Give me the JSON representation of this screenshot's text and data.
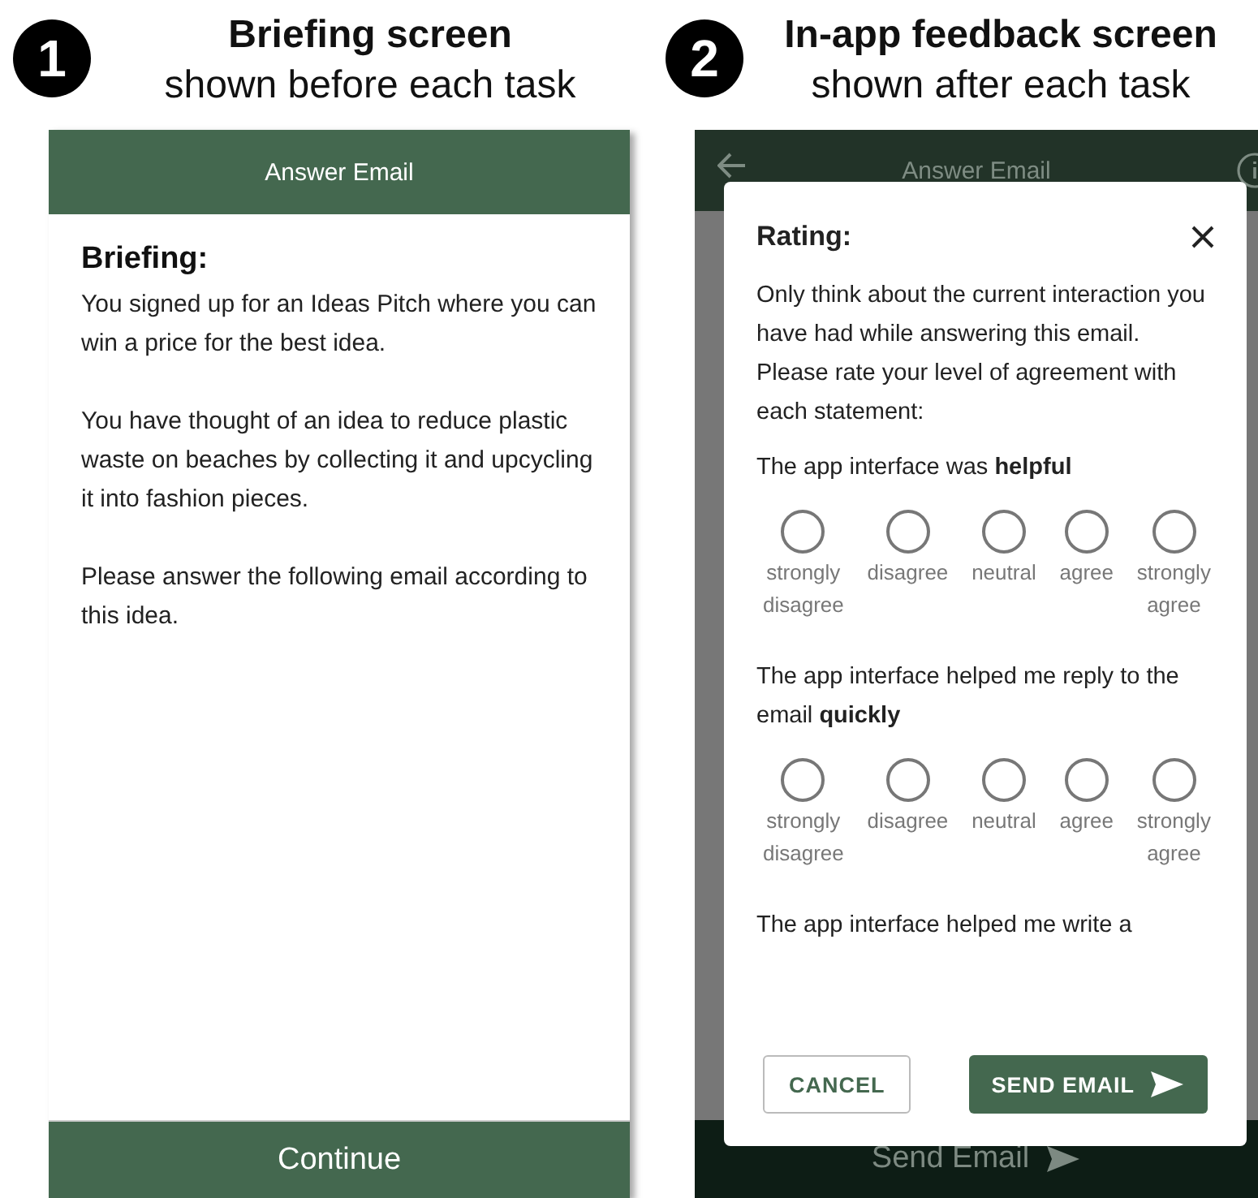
{
  "panels": [
    {
      "kind": "briefing",
      "number": "1",
      "title": "Briefing screen",
      "subtitle": "shown before each task",
      "app_bar": {
        "title": "Answer Email"
      },
      "heading": "Briefing:",
      "paragraphs": [
        "You signed up for an Ideas Pitch where you can win a price for the best idea.",
        "You have thought of an idea to reduce plastic waste on beaches by collecting it and upcycling it into fashion pieces.",
        "Please answer the following email according to this idea."
      ],
      "bottom_button": "Continue"
    },
    {
      "kind": "feedback",
      "number": "2",
      "title": "In-app feedback screen",
      "subtitle": "shown after each task",
      "app_bar": {
        "title": "Answer Email"
      },
      "bottom_button": "Send Email",
      "dialog": {
        "title": "Rating:",
        "intro": [
          "Only think about the current interaction you have had while answering this email.",
          "Please rate your level of agreement with each statement:"
        ],
        "questions": [
          {
            "text": "The app interface was **helpful**",
            "options": [
              {
                "label": "strongly disagree",
                "selected": false
              },
              {
                "label": "disagree",
                "selected": false
              },
              {
                "label": "neutral",
                "selected": false
              },
              {
                "label": "agree",
                "selected": false
              },
              {
                "label": "strongly agree",
                "selected": false
              }
            ]
          },
          {
            "text": "The app interface helped me reply to the email **quickly**",
            "options": [
              {
                "label": "strongly disagree",
                "selected": false
              },
              {
                "label": "disagree",
                "selected": false
              },
              {
                "label": "neutral",
                "selected": false
              },
              {
                "label": "agree",
                "selected": false
              },
              {
                "label": "strongly agree",
                "selected": false
              }
            ]
          },
          {
            "text": "The app interface helped me write a"
          }
        ],
        "cancel": "CANCEL",
        "send": "SEND EMAIL"
      }
    }
  ]
}
